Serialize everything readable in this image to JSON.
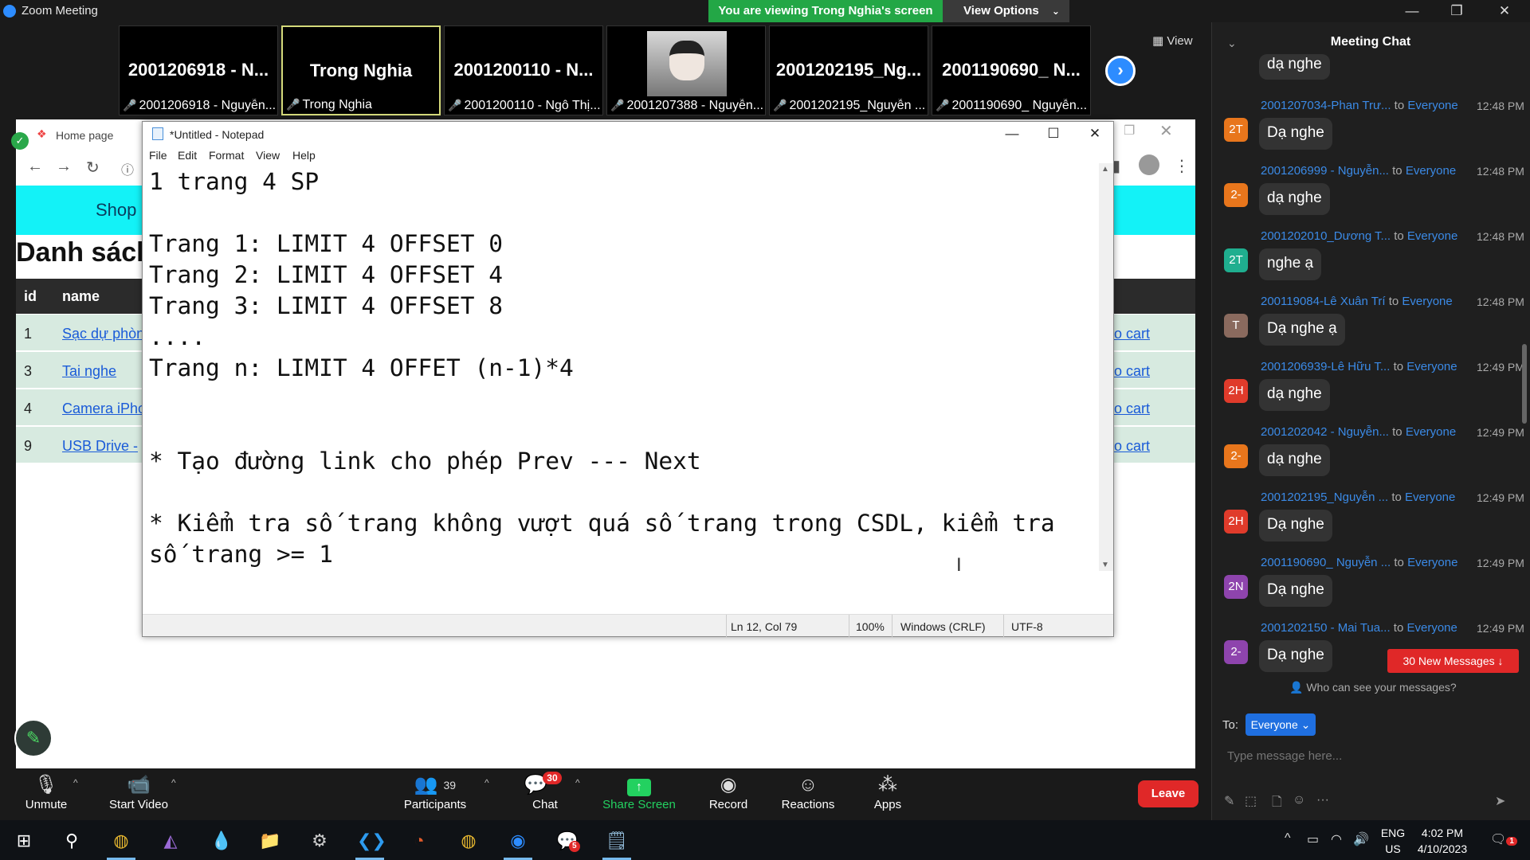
{
  "app": {
    "title": "Zoom Meeting",
    "viewing_banner": "You are viewing Trong Nghia's screen",
    "view_options": "View Options",
    "view_label": "View"
  },
  "participants": [
    {
      "big": "2001206918 - N...",
      "small": "2001206918 - Nguyễn..."
    },
    {
      "big": "Trong Nghia",
      "small": "Trong Nghia"
    },
    {
      "big": "2001200110 - N...",
      "small": "2001200110 - Ngô Thị..."
    },
    {
      "big": "",
      "small": "2001207388 - Nguyễn..."
    },
    {
      "big": "2001202195_Ng...",
      "small": "2001202195_Nguyễn ..."
    },
    {
      "big": "2001190690_ N...",
      "small": "2001190690_ Nguyễn..."
    }
  ],
  "browser": {
    "tab_title": "Home page",
    "shop": "Shop",
    "heading": "Danh sách",
    "columns": [
      "id",
      "name"
    ],
    "rows": [
      {
        "id": "1",
        "name": "Sạc dự phòn",
        "cart": "o cart"
      },
      {
        "id": "3",
        "name": "Tai nghe",
        "cart": "o cart"
      },
      {
        "id": "4",
        "name": "Camera iPho",
        "cart": "o cart"
      },
      {
        "id": "9",
        "name": "USB Drive - ",
        "cart": "o cart"
      }
    ]
  },
  "notepad": {
    "title": "*Untitled - Notepad",
    "menu": [
      "File",
      "Edit",
      "Format",
      "View",
      "Help"
    ],
    "content": "1 trang 4 SP\n\nTrang 1: LIMIT 4 OFFSET 0\nTrang 2: LIMIT 4 OFFSET 4\nTrang 3: LIMIT 4 OFFSET 8\n....\nTrang n: LIMIT 4 OFFET (n-1)*4\n\n\n* Tạo đường link cho phép Prev --- Next\n\n* Kiểm tra số trang không vượt quá số trang trong CSDL, kiểm tra số trang >= 1",
    "status": {
      "position": "Ln 12, Col 79",
      "zoom": "100%",
      "line_ending": "Windows (CRLF)",
      "encoding": "UTF-8"
    }
  },
  "chat": {
    "title": "Meeting Chat",
    "top_partial": "dạ nghe",
    "messages": [
      {
        "from": "2001207034-Phan Trư...",
        "to": "to",
        "target": "Everyone",
        "time": "12:48 PM",
        "avatar": "2T",
        "avatar_color": "#e8761c",
        "text": "Dạ nghe"
      },
      {
        "from": "2001206999 - Nguyễn...",
        "to": "to",
        "target": "Everyone",
        "time": "12:48 PM",
        "avatar": "2-",
        "avatar_color": "#e8761c",
        "text": "dạ nghe"
      },
      {
        "from": "2001202010_Dương T...",
        "to": "to",
        "target": "Everyone",
        "time": "12:48 PM",
        "avatar": "2T",
        "avatar_color": "#1fae8f",
        "text": "nghe ạ"
      },
      {
        "from": "200119084-Lê Xuân Trí",
        "to": "to",
        "target": "Everyone",
        "time": "12:48 PM",
        "avatar": "T",
        "avatar_color": "#8a6a5e",
        "text": "Dạ nghe ạ"
      },
      {
        "from": "2001206939-Lê Hữu T...",
        "to": "to",
        "target": "Everyone",
        "time": "12:49 PM",
        "avatar": "2H",
        "avatar_color": "#e03b2b",
        "text": "dạ nghe"
      },
      {
        "from": "2001202042 - Nguyễn...",
        "to": "to",
        "target": "Everyone",
        "time": "12:49 PM",
        "avatar": "2-",
        "avatar_color": "#e8761c",
        "text": "dạ nghe"
      },
      {
        "from": "2001202195_Nguyễn ...",
        "to": "to",
        "target": "Everyone",
        "time": "12:49 PM",
        "avatar": "2H",
        "avatar_color": "#e03b2b",
        "text": "Dạ nghe"
      },
      {
        "from": "2001190690_ Nguyễn ...",
        "to": "to",
        "target": "Everyone",
        "time": "12:49 PM",
        "avatar": "2N",
        "avatar_color": "#8e44ad",
        "text": "Dạ nghe"
      },
      {
        "from": "2001202150 - Mai Tua...",
        "to": "to",
        "target": "Everyone",
        "time": "12:49 PM",
        "avatar": "2-",
        "avatar_color": "#8e44ad",
        "text": "Dạ nghe"
      }
    ],
    "new_messages": "30 New Messages",
    "who_can_see": "Who can see your messages?",
    "to_label": "To:",
    "to_value": "Everyone",
    "input_placeholder": "Type message here..."
  },
  "toolbar": {
    "unmute": "Unmute",
    "start_video": "Start Video",
    "participants": "Participants",
    "participants_count": "39",
    "chat": "Chat",
    "chat_badge": "30",
    "share_screen": "Share Screen",
    "record": "Record",
    "reactions": "Reactions",
    "apps": "Apps",
    "leave": "Leave"
  },
  "taskbar": {
    "lang_1": "ENG",
    "lang_2": "US",
    "time": "4:02 PM",
    "date": "4/10/2023",
    "notification_count": "1",
    "zalo_badge": "5"
  }
}
